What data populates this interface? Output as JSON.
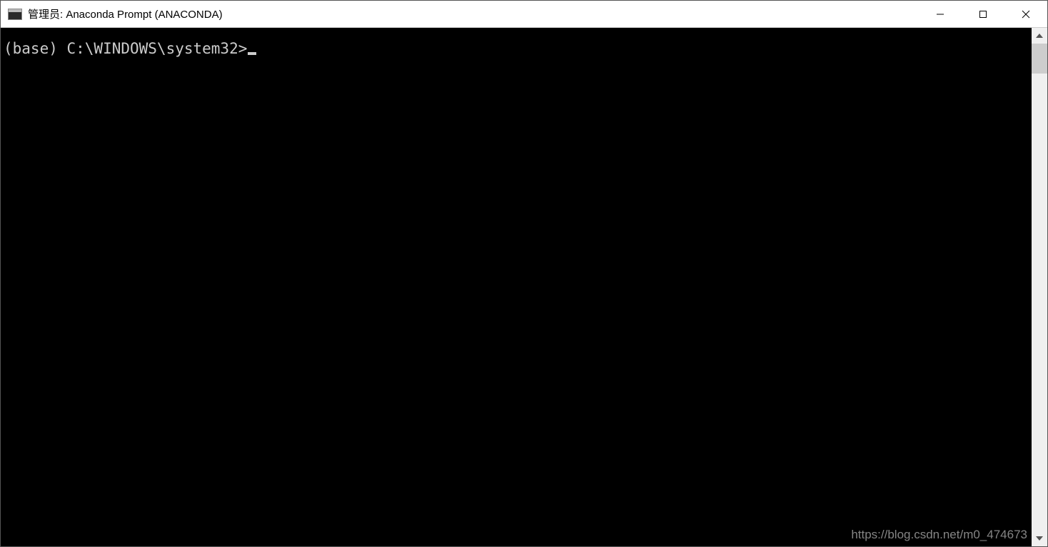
{
  "window": {
    "title": "管理员: Anaconda Prompt (ANACONDA)"
  },
  "terminal": {
    "prompt": "(base) C:\\WINDOWS\\system32>"
  },
  "watermark": {
    "text": "https://blog.csdn.net/m0_474673"
  }
}
